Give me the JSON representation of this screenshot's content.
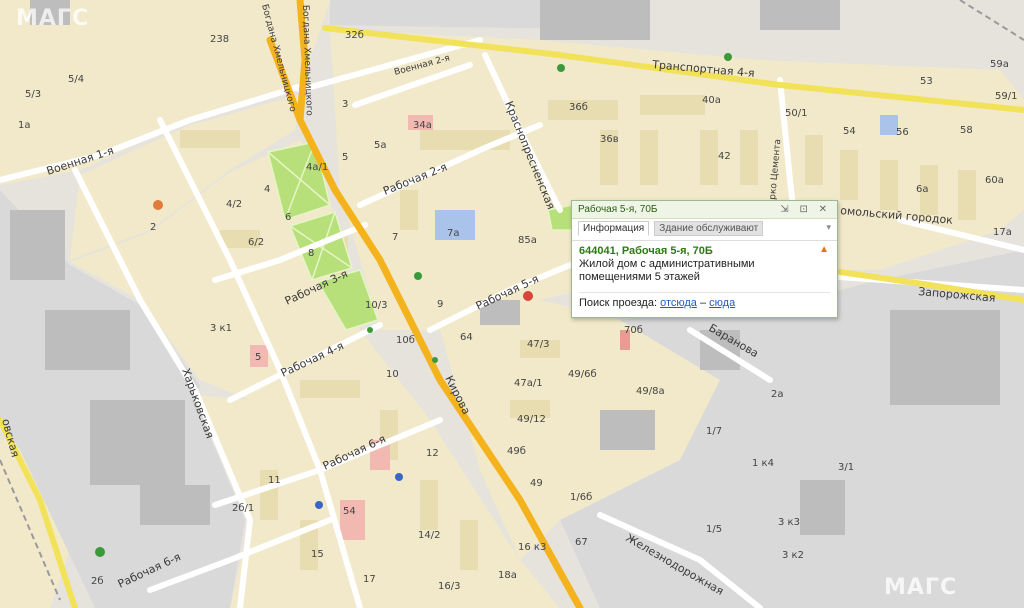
{
  "map": {
    "colors": {
      "background": "#e8e4dc",
      "block": "#f1e9c9",
      "industrial": "#dcdcdc",
      "park": "#b8e07a",
      "main_road": "#f4b21c",
      "secondary_road": "#f2e25a",
      "local_road": "#ffffff"
    },
    "street_labels": [
      "Транспортная 4-я",
      "Военная 2-я",
      "Военная 1-я",
      "Богдана Хмельницкого",
      "Богдана Хмельницкого",
      "Рабочая 2-я",
      "Краснопресненская",
      "Рабочая 3-я",
      "Рабочая 4-я",
      "Рабочая 5-я",
      "Кирова",
      "Харьковская",
      "Рабочая 6-я",
      "Рабочая 6-я",
      "Баранова",
      "Запорожская",
      "омольский городок",
      "Железнодорожная",
      "рко Цемента",
      "овская"
    ],
    "house_numbers": [
      "32б",
      "238",
      "5/3",
      "5/4",
      "1а",
      "4а/1",
      "3",
      "34а",
      "5а",
      "5",
      "4",
      "2",
      "4/2",
      "6",
      "6/2",
      "8",
      "7",
      "7а",
      "85а",
      "9",
      "10/3",
      "3 к1",
      "5",
      "10б",
      "64",
      "47/3",
      "10",
      "47а/1",
      "49/6б",
      "49/12",
      "49б",
      "49",
      "1/6б",
      "12",
      "11",
      "2б/1",
      "54",
      "14/2",
      "15",
      "17",
      "16/3",
      "16 к3",
      "18а",
      "67",
      "2б",
      "36б",
      "36в",
      "40а",
      "42",
      "50/1",
      "54",
      "56",
      "53",
      "59а",
      "59/1",
      "58",
      "60а",
      "6а",
      "17а",
      "70б",
      "49/8а",
      "2а",
      "1/7",
      "1 к4",
      "3/1",
      "1/5",
      "3 к3",
      "3 к2"
    ],
    "watermarks": [
      "МАГС",
      "МАГС"
    ]
  },
  "popup": {
    "title": "Рабочая 5-я, 70Б",
    "controls": "⇲ ⊡ ✕",
    "tabs": [
      "Информация",
      "Здание обслуживают"
    ],
    "address": "644041, Рабочая 5-я, 70Б",
    "description": "Жилой дом с административными помещениями 5 этажей",
    "route_label": "Поиск проезда:",
    "route_from": "отсюда",
    "route_sep": "–",
    "route_to": "сюда",
    "warning_icon": "warning-triangle-icon"
  }
}
